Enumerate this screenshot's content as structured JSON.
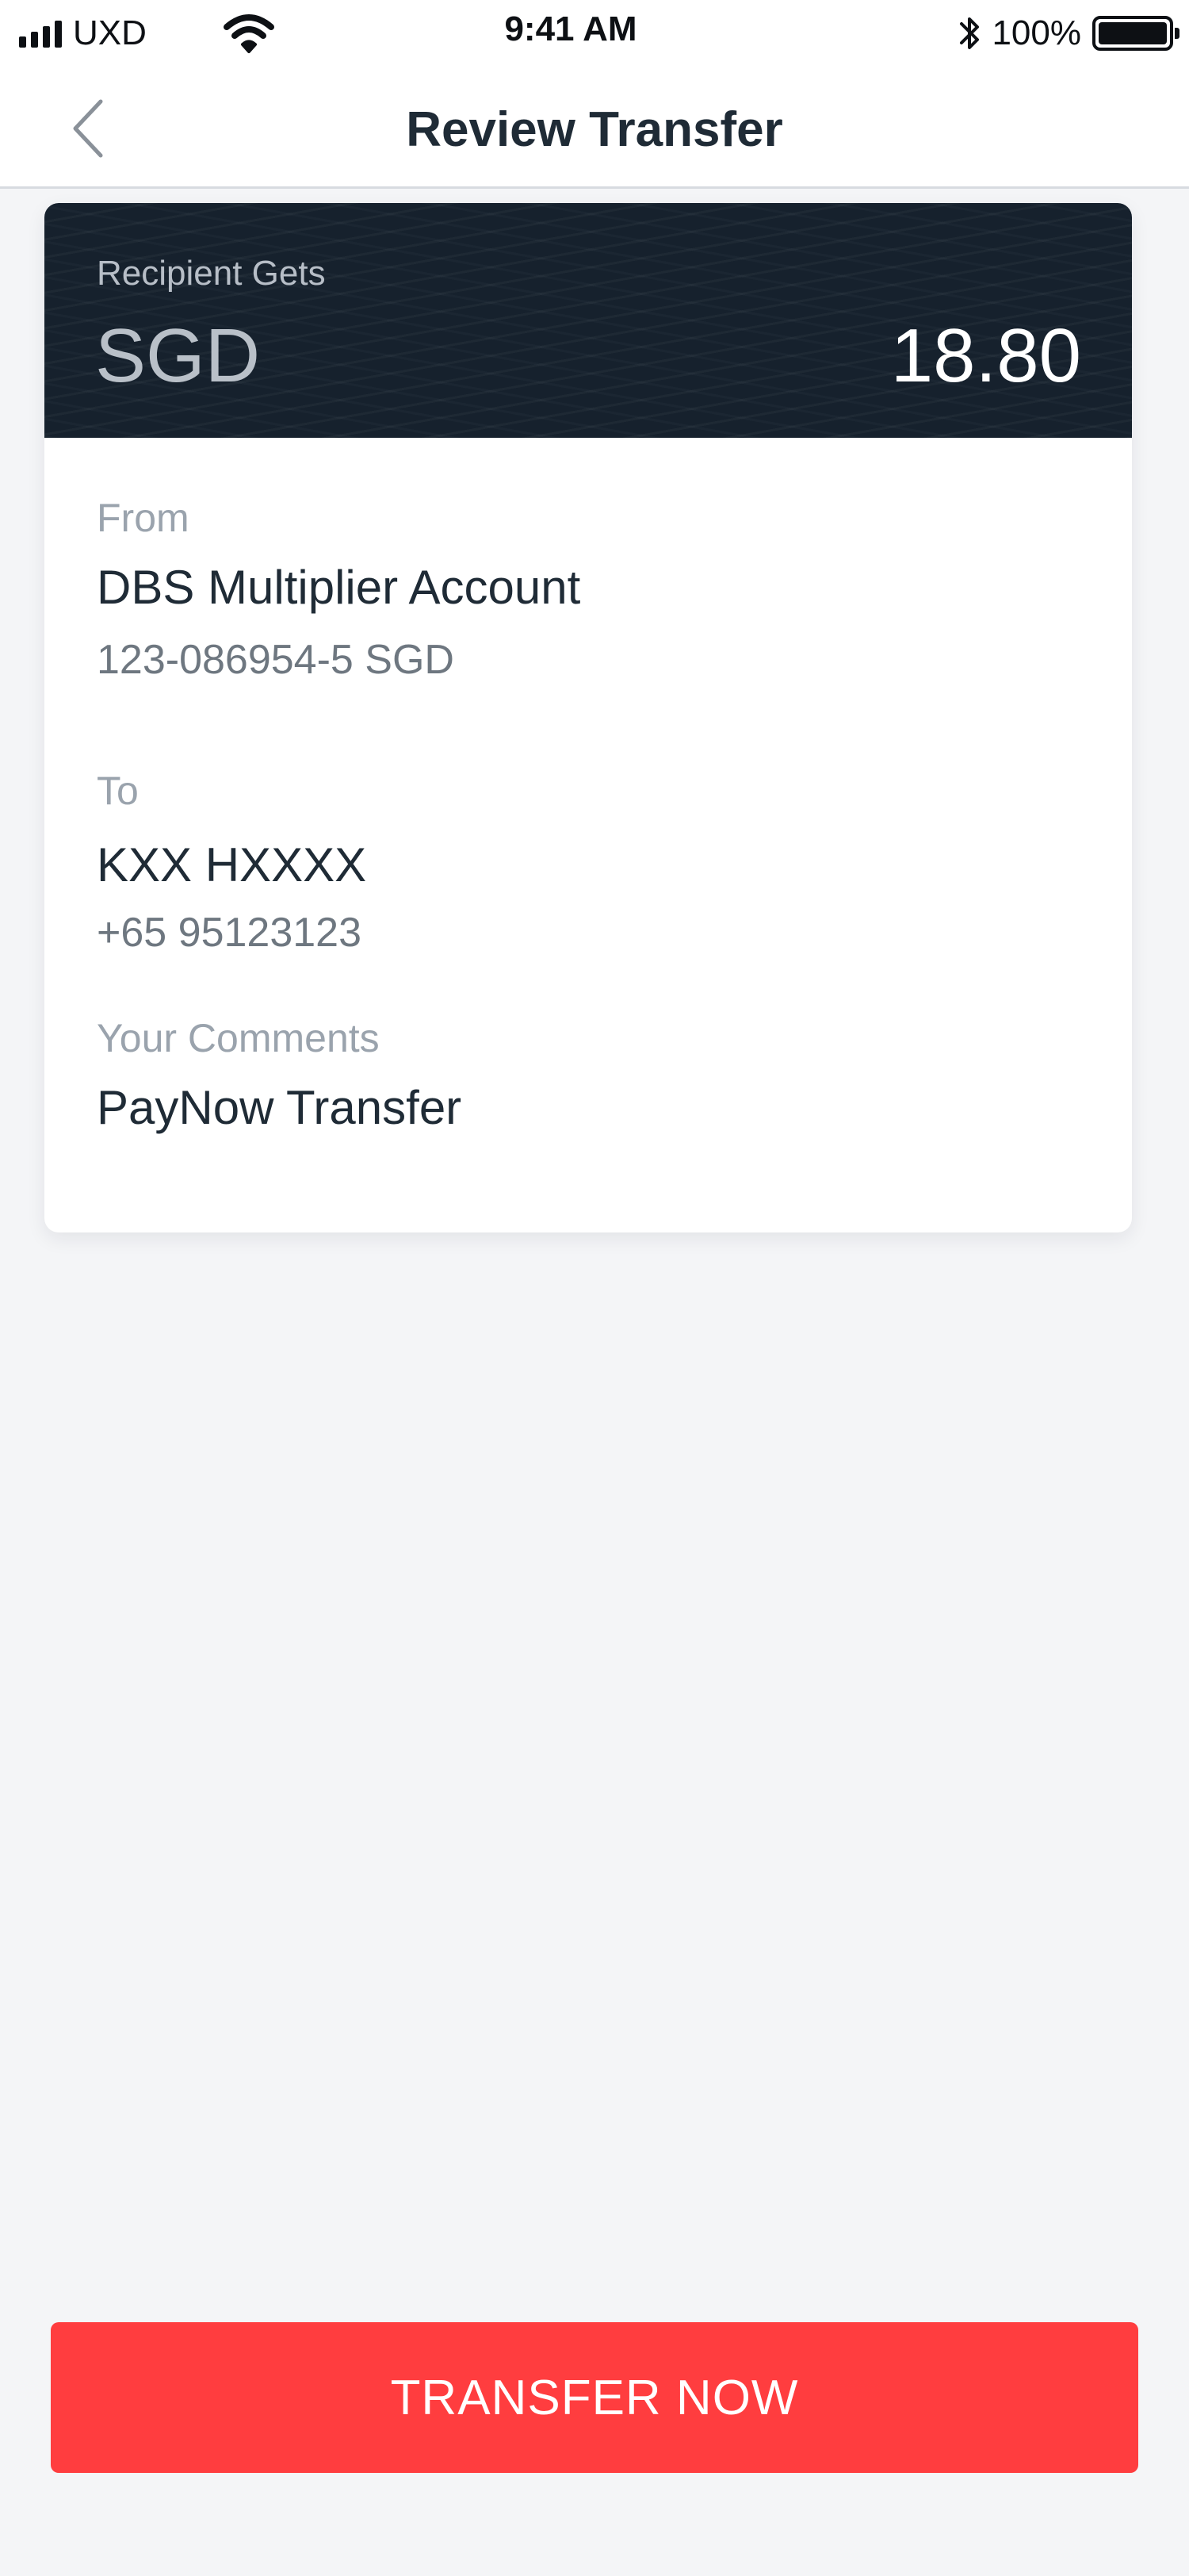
{
  "status_bar": {
    "carrier": "UXD",
    "time": "9:41 AM",
    "battery": "100%"
  },
  "nav": {
    "title": "Review Transfer",
    "back_icon": "chevron-left-icon"
  },
  "summary": {
    "label": "Recipient Gets",
    "currency": "SGD",
    "amount": "18.80"
  },
  "from": {
    "label": "From",
    "account_name": "DBS Multiplier Account",
    "account_number": "123-086954-5 SGD"
  },
  "to": {
    "label": "To",
    "name": "KXX HXXXX",
    "phone": "+65 95123123"
  },
  "comments": {
    "label": "Your Comments",
    "value": "PayNow Transfer"
  },
  "action": {
    "label": "TRANSFER NOW"
  },
  "colors": {
    "accent": "#ff3d3f",
    "header_dark": "#16212d",
    "background": "#f4f5f7"
  }
}
